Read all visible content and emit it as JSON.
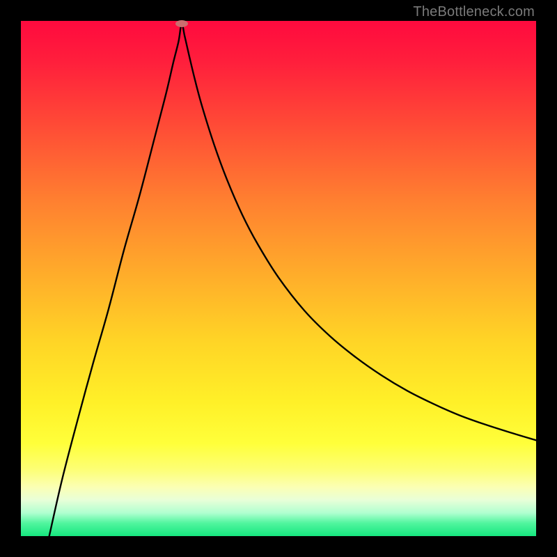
{
  "watermark": "TheBottleneck.com",
  "chart_data": {
    "type": "line",
    "title": "",
    "xlabel": "",
    "ylabel": "",
    "xlim": [
      0,
      100
    ],
    "ylim": [
      0,
      100
    ],
    "background_gradient": {
      "stops": [
        {
          "pos": 0.0,
          "color": "#ff0a3e"
        },
        {
          "pos": 0.08,
          "color": "#ff1f3c"
        },
        {
          "pos": 0.2,
          "color": "#ff4a36"
        },
        {
          "pos": 0.35,
          "color": "#ff8030"
        },
        {
          "pos": 0.5,
          "color": "#ffaf2a"
        },
        {
          "pos": 0.62,
          "color": "#ffd426"
        },
        {
          "pos": 0.74,
          "color": "#fff028"
        },
        {
          "pos": 0.82,
          "color": "#ffff3a"
        },
        {
          "pos": 0.87,
          "color": "#fdff74"
        },
        {
          "pos": 0.905,
          "color": "#fbffb4"
        },
        {
          "pos": 0.93,
          "color": "#e8ffd8"
        },
        {
          "pos": 0.955,
          "color": "#b0ffd0"
        },
        {
          "pos": 0.975,
          "color": "#50f59e"
        },
        {
          "pos": 1.0,
          "color": "#16e77f"
        }
      ]
    },
    "marker": {
      "x": 31.2,
      "y": 99.4,
      "color": "#cb6e6f"
    },
    "series": [
      {
        "name": "curve",
        "color": "#000000",
        "x": [
          5.5,
          8,
          11,
          14,
          17,
          20,
          23,
          26,
          28.2,
          29.6,
          30.6,
          31.2,
          31.8,
          32.6,
          33.8,
          35.2,
          37.5,
          40,
          43,
          46,
          50,
          55,
          60,
          65,
          70,
          75,
          80,
          85,
          90,
          95,
          100
        ],
        "y": [
          0,
          11,
          22.5,
          33.5,
          44,
          55.5,
          66,
          77.5,
          86,
          92,
          96,
          99.4,
          97,
          93.5,
          88.5,
          83.3,
          76,
          69.2,
          62.3,
          56.6,
          50.2,
          43.8,
          38.8,
          34.7,
          31.2,
          28.2,
          25.7,
          23.5,
          21.7,
          20.1,
          18.6
        ]
      }
    ]
  }
}
